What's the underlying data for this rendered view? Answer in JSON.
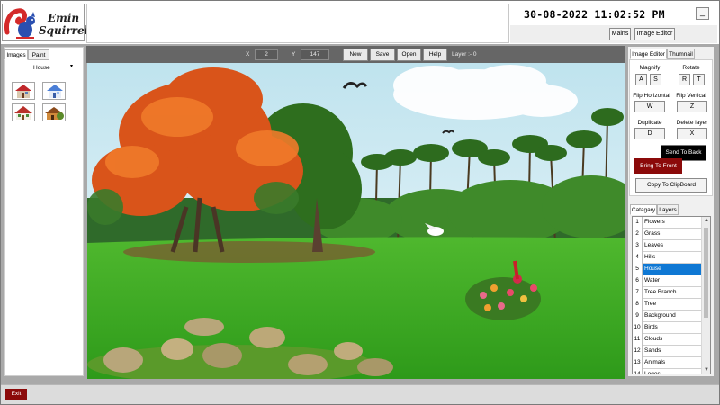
{
  "app": {
    "brand_line1": "Emin",
    "brand_line2": "Squirrel",
    "datetime": "30-08-2022 11:02:52 PM",
    "minimize_label": "_"
  },
  "top_buttons": {
    "mains": "Mains",
    "image_editor": "Image Editor"
  },
  "left_panel": {
    "tabs": [
      "Images",
      "Paint"
    ],
    "category_select": "House",
    "thumbnail_icons": [
      "house-red-icon",
      "house-blue-icon",
      "house-cottage-icon",
      "house-brown-icon"
    ]
  },
  "toolbar": {
    "x_label": "X",
    "x_value": "2",
    "y_label": "Y",
    "y_value": "147",
    "buttons": [
      "New",
      "Save",
      "Open",
      "Help"
    ],
    "layer_text": "Layer :- 0"
  },
  "canvas": {
    "scene": "landscape-collage"
  },
  "image_editor": {
    "tabs": [
      "Image Editor",
      "Thumnail"
    ],
    "magnify_label": "Magnify",
    "magnify_keys": [
      "A",
      "S"
    ],
    "rotate_label": "Rotate",
    "rotate_keys": [
      "R",
      "T"
    ],
    "flip_h_label": "Flip Horizontal",
    "flip_h_key": "W",
    "flip_v_label": "Flip Vertical",
    "flip_v_key": "Z",
    "duplicate_label": "Duplicate",
    "duplicate_key": "D",
    "delete_label": "Delete layer",
    "delete_key": "X",
    "send_back": "Send To Back",
    "bring_front": "Bring To Front",
    "copy_clipboard": "Copy To ClipBoard"
  },
  "category_panel": {
    "tabs": [
      "Catagary",
      "Layers"
    ],
    "items": [
      {
        "n": "1",
        "label": "Flowers"
      },
      {
        "n": "2",
        "label": "Grass"
      },
      {
        "n": "3",
        "label": "Leaves"
      },
      {
        "n": "4",
        "label": "Hills"
      },
      {
        "n": "5",
        "label": "House"
      },
      {
        "n": "6",
        "label": "Water"
      },
      {
        "n": "7",
        "label": "Tree Branch"
      },
      {
        "n": "8",
        "label": "Tree"
      },
      {
        "n": "9",
        "label": "Background"
      },
      {
        "n": "10",
        "label": "Birds"
      },
      {
        "n": "11",
        "label": "Clouds"
      },
      {
        "n": "12",
        "label": "Sands"
      },
      {
        "n": "13",
        "label": "Animals"
      },
      {
        "n": "14",
        "label": "Logos"
      }
    ],
    "selected_index": 4
  },
  "footer": {
    "exit": "Exit"
  },
  "colors": {
    "accent_red": "#8b0a0a",
    "selection_blue": "#0f78d4",
    "toolbar_gray": "#666666"
  }
}
